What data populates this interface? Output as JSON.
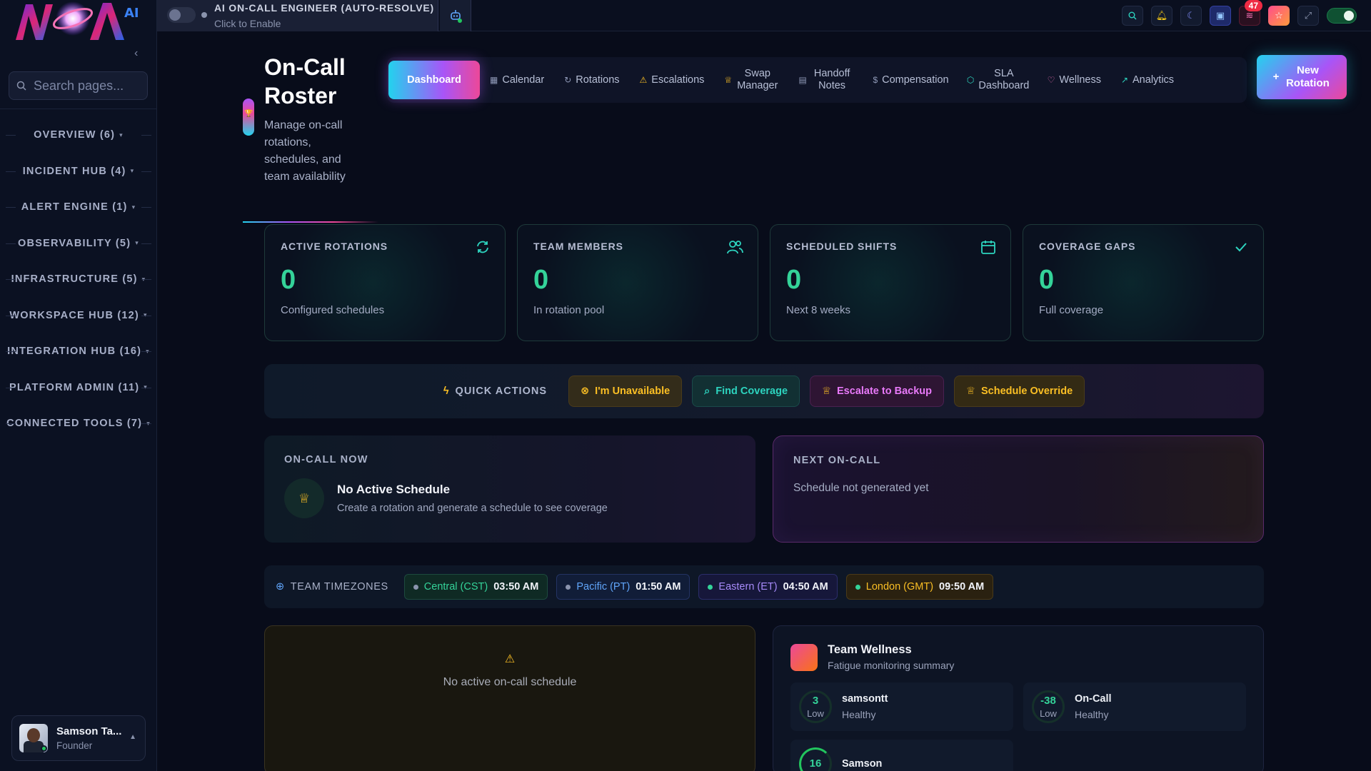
{
  "topbar": {
    "ai_title": "AI ON-CALL ENGINEER (AUTO-RESOLVE)",
    "ai_subtitle": "Click to Enable",
    "notification_count": "47",
    "icons": [
      "search-icon",
      "bell-icon",
      "moon-icon",
      "chat-icon",
      "grid-icon",
      "star-icon",
      "expand-icon",
      "toggle-icon"
    ]
  },
  "sidebar": {
    "search_placeholder": "Search pages...",
    "groups": [
      {
        "label": "OVERVIEW (6)"
      },
      {
        "label": "INCIDENT HUB (4)"
      },
      {
        "label": "ALERT ENGINE (1)"
      },
      {
        "label": "OBSERVABILITY (5)"
      },
      {
        "label": "INFRASTRUCTURE (5)"
      },
      {
        "label": "WORKSPACE HUB (12)"
      },
      {
        "label": "INTEGRATION HUB (16)"
      },
      {
        "label": "PLATFORM ADMIN (11)"
      },
      {
        "label": "CONNECTED TOOLS (7)"
      }
    ],
    "user": {
      "name": "Samson Ta...",
      "role": "Founder"
    }
  },
  "header": {
    "title": "On-Call Roster",
    "description": "Manage on-call rotations, schedules, and team availability"
  },
  "tabs": [
    {
      "label": "Dashboard",
      "icon": ""
    },
    {
      "label": "Calendar",
      "icon": "calendar-icon"
    },
    {
      "label": "Rotations",
      "icon": "rotate-icon"
    },
    {
      "label": "Escalations",
      "icon": "warning-icon"
    },
    {
      "label": "Swap Manager",
      "icon": "trophy-icon"
    },
    {
      "label": "Handoff Notes",
      "icon": "note-icon"
    },
    {
      "label": "Compensation",
      "icon": "dollar-icon"
    },
    {
      "label": "SLA Dashboard",
      "icon": "shield-icon"
    },
    {
      "label": "Wellness",
      "icon": "heart-icon"
    },
    {
      "label": "Analytics",
      "icon": "trend-icon"
    }
  ],
  "new_rotation_label": "New Rotation",
  "stats": [
    {
      "label": "ACTIVE ROTATIONS",
      "value": "0",
      "sub": "Configured schedules"
    },
    {
      "label": "TEAM MEMBERS",
      "value": "0",
      "sub": "In rotation pool"
    },
    {
      "label": "SCHEDULED SHIFTS",
      "value": "0",
      "sub": "Next 8 weeks"
    },
    {
      "label": "COVERAGE GAPS",
      "value": "0",
      "sub": "Full coverage"
    }
  ],
  "quick_actions": {
    "label": "QUICK ACTIONS",
    "buttons": [
      "I'm Unavailable",
      "Find Coverage",
      "Escalate to Backup",
      "Schedule Override"
    ]
  },
  "oncall_now": {
    "label": "ON-CALL NOW",
    "title": "No Active Schedule",
    "subtitle": "Create a rotation and generate a schedule to see coverage"
  },
  "next_oncall": {
    "label": "NEXT ON-CALL",
    "subtitle": "Schedule not generated yet"
  },
  "timezones": {
    "label": "TEAM TIMEZONES",
    "items": [
      {
        "zone": "Central (CST)",
        "time": "03:50 AM"
      },
      {
        "zone": "Pacific (PT)",
        "time": "01:50 AM"
      },
      {
        "zone": "Eastern (ET)",
        "time": "04:50 AM"
      },
      {
        "zone": "London (GMT)",
        "time": "09:50 AM"
      }
    ]
  },
  "schedule_panel": {
    "text": "No active on-call schedule"
  },
  "wellness": {
    "title": "Team Wellness",
    "subtitle": "Fatigue monitoring summary",
    "members": [
      {
        "score": "3",
        "level": "Low",
        "name": "samsontt",
        "status": "Healthy"
      },
      {
        "score": "-38",
        "level": "Low",
        "name": "On-Call",
        "status": "Healthy"
      },
      {
        "score": "16",
        "level": "",
        "name": "Samson",
        "status": ""
      }
    ]
  },
  "colors": {
    "accent_cyan": "#22d3ee",
    "accent_purple": "#a855f7",
    "accent_pink": "#ec4899",
    "stat_green": "#34d399"
  }
}
